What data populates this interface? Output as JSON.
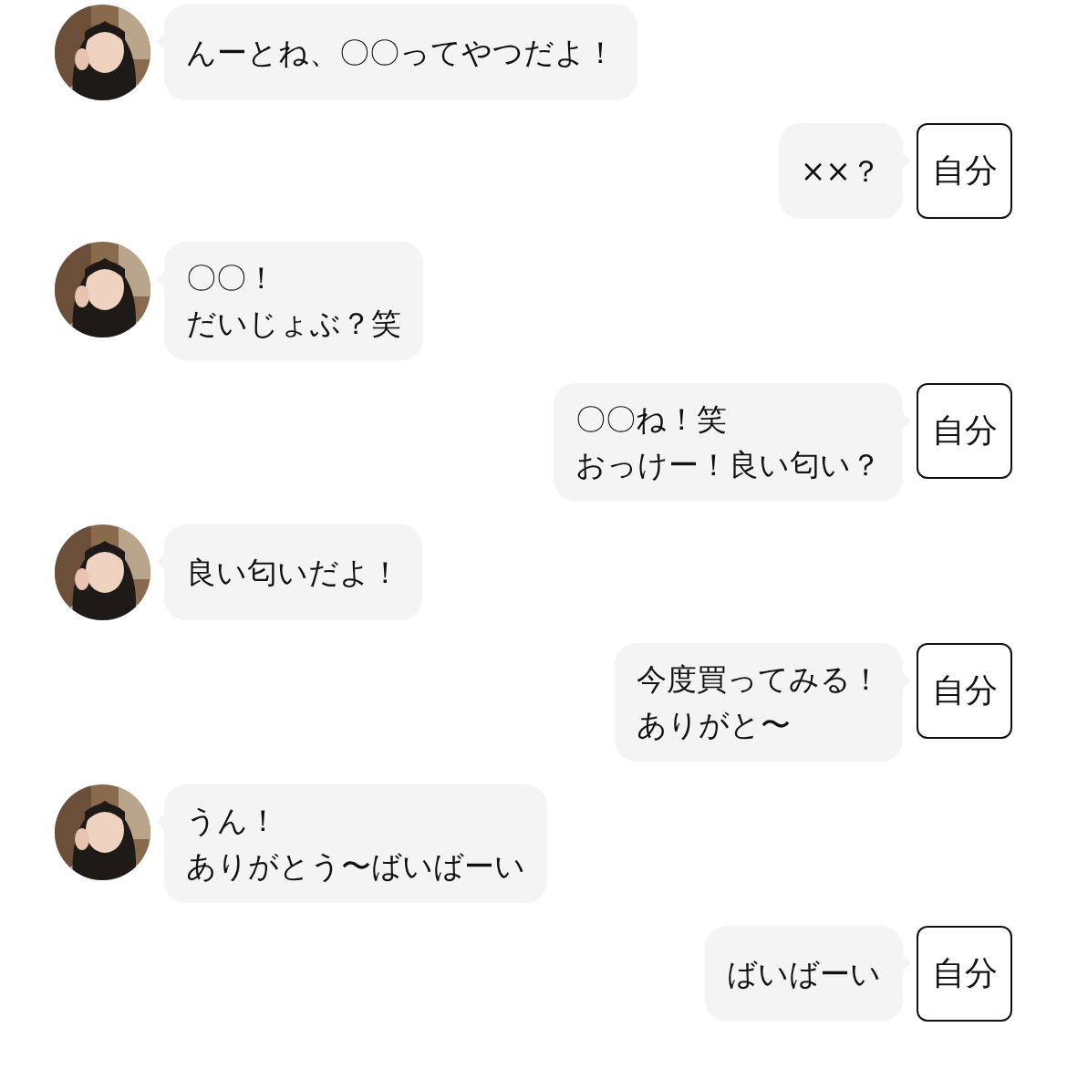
{
  "messages": [
    {
      "kind": "received",
      "lines": [
        "んーとね、〇〇ってやつだよ！"
      ]
    },
    {
      "kind": "sent",
      "lines": [
        "××？"
      ],
      "sender_label": "自分"
    },
    {
      "kind": "received",
      "lines": [
        "〇〇！",
        "だいじょぶ？笑"
      ]
    },
    {
      "kind": "sent",
      "lines": [
        "〇〇ね！笑",
        "おっけー！良い匂い？"
      ],
      "sender_label": "自分"
    },
    {
      "kind": "received",
      "lines": [
        "良い匂いだよ！"
      ]
    },
    {
      "kind": "sent",
      "lines": [
        "今度買ってみる！",
        "ありがと〜"
      ],
      "sender_label": "自分"
    },
    {
      "kind": "received",
      "lines": [
        "うん！",
        "ありがとう〜ばいばーい"
      ]
    },
    {
      "kind": "sent",
      "lines": [
        "ばいばーい"
      ],
      "sender_label": "自分"
    }
  ]
}
